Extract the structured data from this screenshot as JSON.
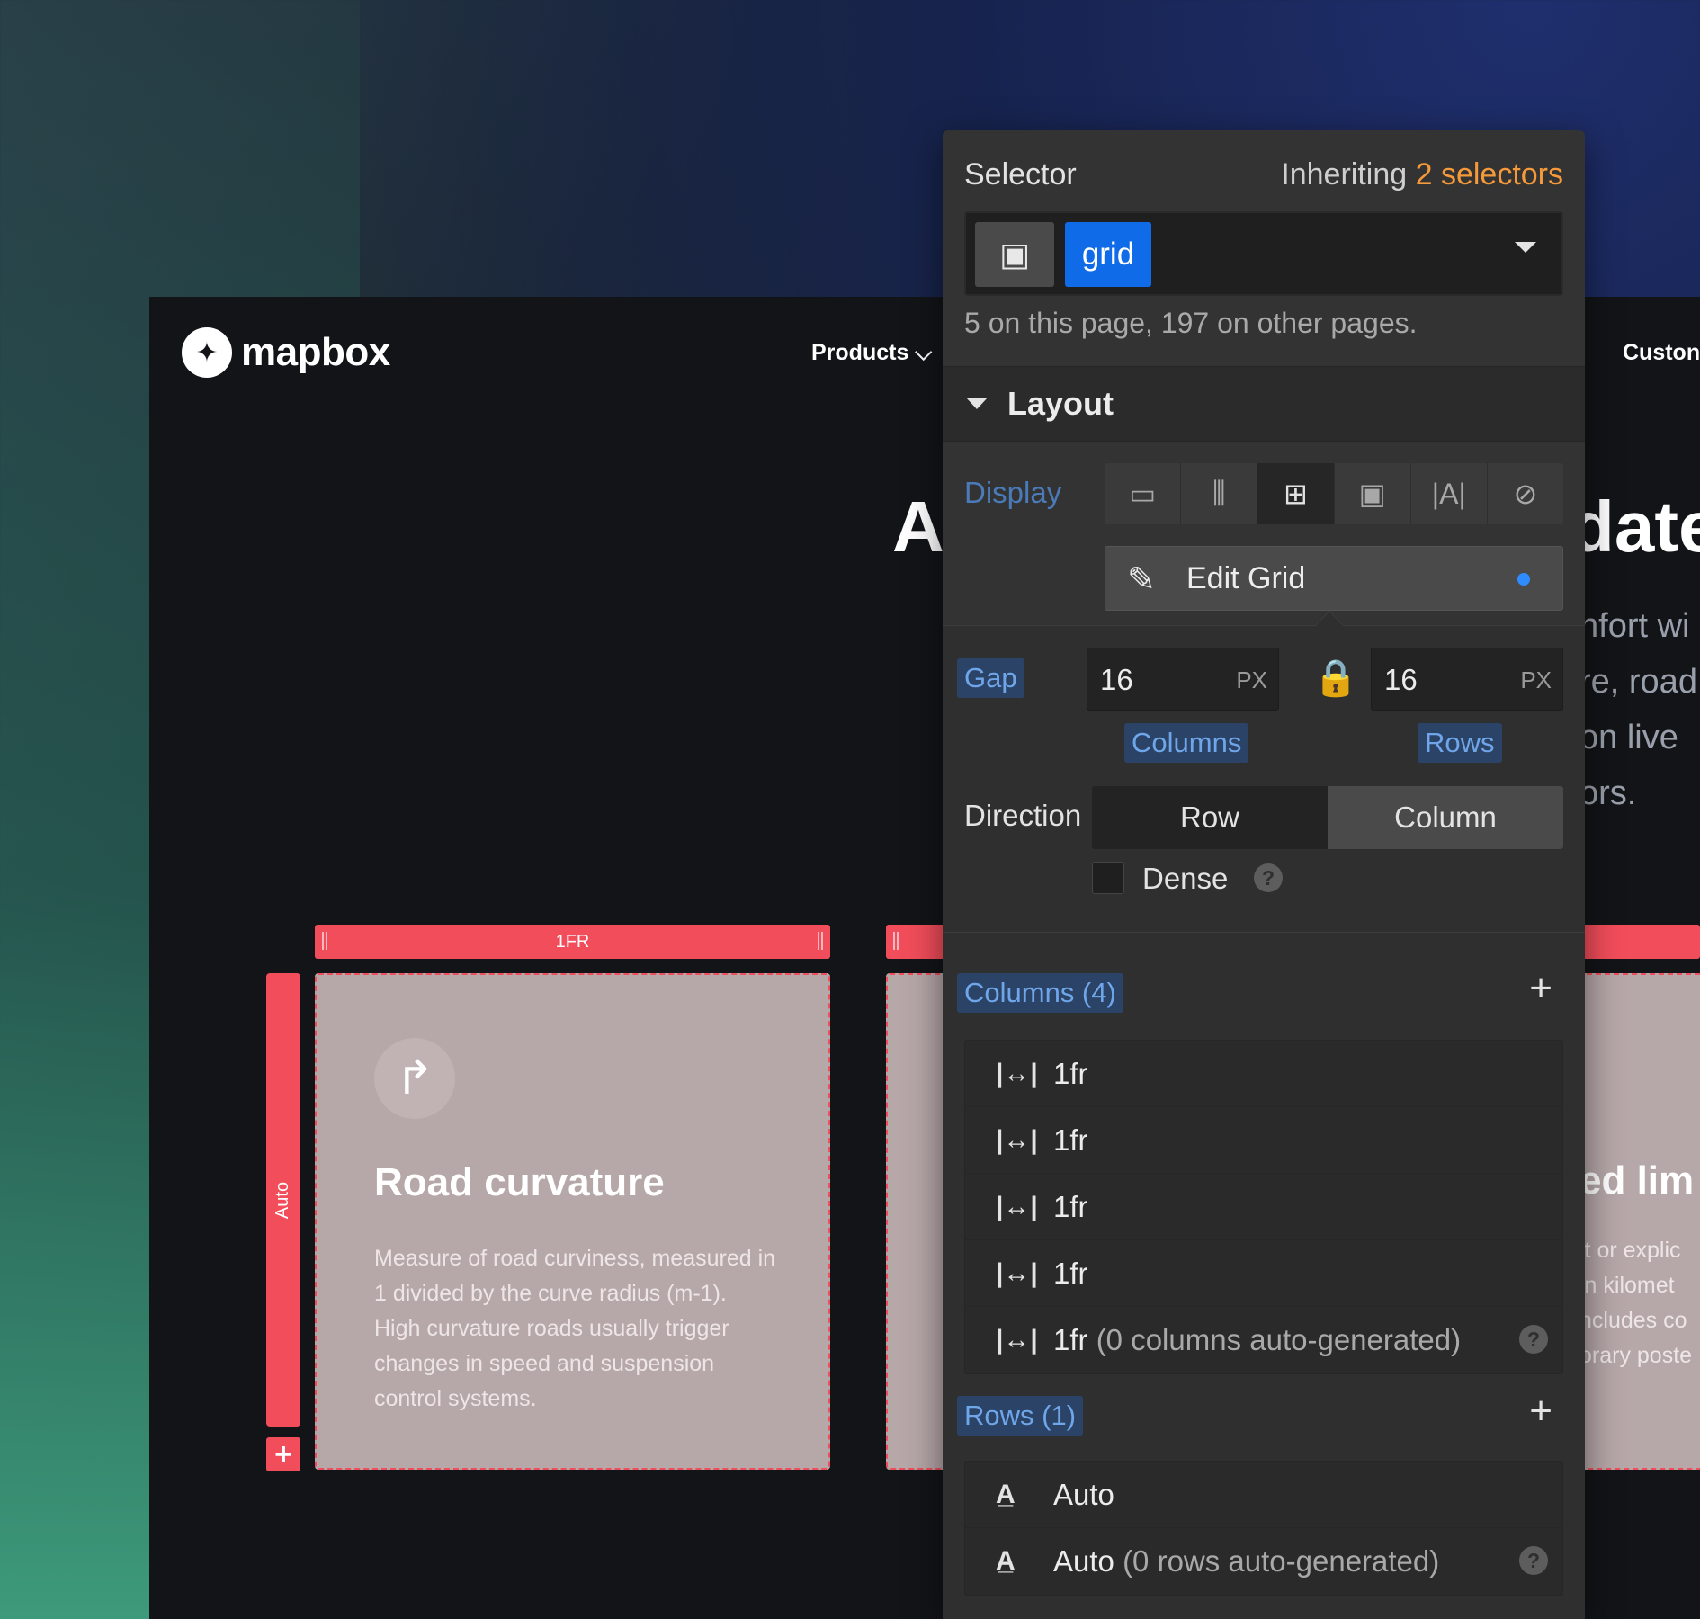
{
  "site": {
    "logo": "mapbox",
    "nav_products": "Products ⌵",
    "nav_customers": "Custon",
    "hero_a": "A",
    "hero_date": "date",
    "hero_lines": [
      "nfort wi",
      "re, road",
      "on live",
      "ors."
    ],
    "col_bar_label": "1FR",
    "row_bar_label": "Auto",
    "row_add": "+",
    "card": {
      "title": "Road curvature",
      "description": "Measure of road curviness, measured in 1 divided by the curve radius (m-1). High curvature roads usually trigger changes in speed and suspension control systems."
    },
    "card_right_title": "ed lim",
    "card_right_lines": [
      "it or explic",
      "in kilomet",
      "ncludes co",
      "orary poste"
    ]
  },
  "panel": {
    "selector_label": "Selector",
    "inheriting_prefix": "Inheriting",
    "inheriting_count": "2 selectors",
    "selector_chip": "grid",
    "selector_count_text": "5 on this page, 197 on other pages.",
    "section_title": "Layout",
    "display_label": "Display",
    "display_options": [
      {
        "icon": "block-icon",
        "glyph": "▭"
      },
      {
        "icon": "flex-icon",
        "glyph": "⫼"
      },
      {
        "icon": "grid-icon",
        "glyph": "⊞"
      },
      {
        "icon": "inline-block-icon",
        "glyph": "▣"
      },
      {
        "icon": "inline-icon",
        "glyph": "|A|"
      },
      {
        "icon": "none-icon",
        "glyph": "⊘"
      }
    ],
    "edit_grid_label": "Edit Grid",
    "gap_label": "Gap",
    "gap_columns_value": "16",
    "gap_rows_value": "16",
    "gap_unit": "PX",
    "columns_label": "Columns",
    "rows_label": "Rows",
    "direction_label": "Direction",
    "direction_row": "Row",
    "direction_column": "Column",
    "direction_selected": "Column",
    "dense_label": "Dense",
    "columns_section": "Columns (4)",
    "column_tracks": [
      "1fr",
      "1fr",
      "1fr",
      "1fr",
      "1fr"
    ],
    "column_auto_note": "(0 columns auto-generated)",
    "rows_section": "Rows (1)",
    "row_tracks": [
      "Auto",
      "Auto"
    ],
    "row_auto_note": "(0 rows auto-generated)",
    "accent_color": "#f59a3a",
    "selection_color": "#0f6be8",
    "grid_overlay_color": "#f24d5a"
  }
}
